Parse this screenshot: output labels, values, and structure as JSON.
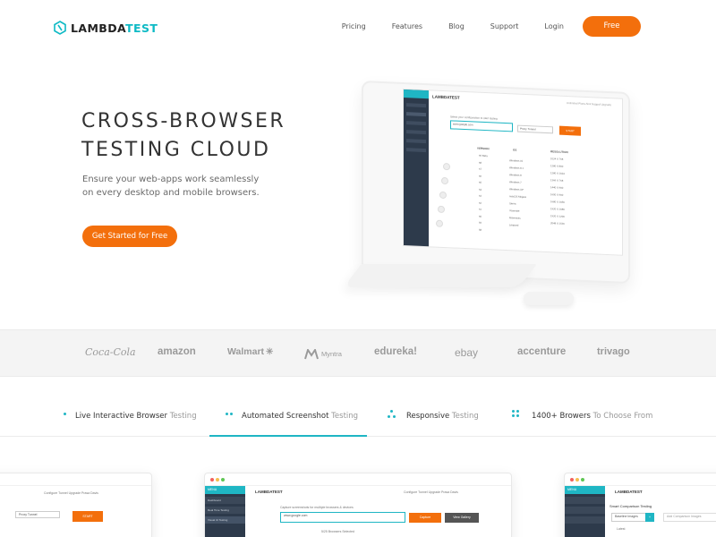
{
  "header": {
    "logo_text": "LAMBDA",
    "logo_accent": "TEST",
    "nav": [
      "Pricing",
      "Features",
      "Blog",
      "Support",
      "Login"
    ],
    "signup_label": "Free Signup"
  },
  "hero": {
    "title_line1": "CROSS-BROWSER",
    "title_line2": "TESTING CLOUD",
    "subtitle": "Ensure your web-apps work seamlessly on every desktop and mobile browsers.",
    "cta_label": "Get Started for Free"
  },
  "monitor": {
    "app_logo": "LAMBDATEST",
    "header_right": "Unlimited Plans   Alok Nagpal   Upgrade",
    "instruction": "Select your configuration to start testing",
    "url_value": "www.google.com",
    "tunnel_value": "Proxy Tunnel",
    "start_label": "START",
    "columns": [
      "VERSION",
      "OS",
      "RESOLUTION"
    ],
    "versions": [
      "69 Beta",
      "68",
      "67",
      "66",
      "65",
      "64",
      "63",
      "62",
      "61",
      "60",
      "59",
      "58"
    ],
    "os": [
      "Windows 10",
      "Windows 8.1",
      "Windows 8",
      "Windows 7",
      "Windows XP",
      "macOS Mojave",
      "Sierra",
      "Yosemite",
      "Mavericks",
      "Leopard"
    ],
    "resolutions": [
      "1024 X 768",
      "1280 X 800",
      "1280 X 1024",
      "1366 X 768",
      "1440 X 900",
      "1600 X 900",
      "1680 X 1050",
      "1920 X 1080",
      "1920 X 1200",
      "2048 X 1536"
    ]
  },
  "brands": [
    "Coca-Cola",
    "amazon",
    "Walmart",
    "Myntra",
    "edureka!",
    "ebay",
    "accenture",
    "trivago"
  ],
  "tabs": [
    {
      "strong": "Live Interactive Browser",
      "muted": "Testing"
    },
    {
      "strong": "Automated Screenshot",
      "muted": "Testing"
    },
    {
      "strong": "Responsive",
      "muted": "Testing"
    },
    {
      "strong": "1400+ Browers",
      "muted": "To Choose From"
    }
  ],
  "previews": {
    "left": {
      "header_right": "Configure Tunnel   Upgrade   Prasa Davis",
      "tunnel_value": "Proxy Tunnel",
      "start_label": "START"
    },
    "center": {
      "menu_label": "MENU",
      "app_logo": "LAMBDATEST",
      "header_right": "Configure Tunnel   Upgrade   Prasa Davis",
      "side_items": [
        "Dashboard",
        "Real Time Testing",
        "Visual UI Testing"
      ],
      "instruction": "Capture screenshots for multiple browsers & devices",
      "url_placeholder": "Place your URL",
      "url_value": "www.google.com",
      "capture_label": "Capture",
      "view_label": "View Gallery",
      "selected": "5/25 Browsers Selected"
    },
    "right": {
      "menu_label": "MENU",
      "app_logo": "LAMBDATEST",
      "title": "Smart Comparison Testing",
      "baseline": "Baseline Images",
      "add_label": "Add Comparison Images",
      "latest": "Latest"
    }
  },
  "colors": {
    "accent": "#f36f0c",
    "brand": "#1fb6c4",
    "sidebar": "#2d3a4b"
  }
}
